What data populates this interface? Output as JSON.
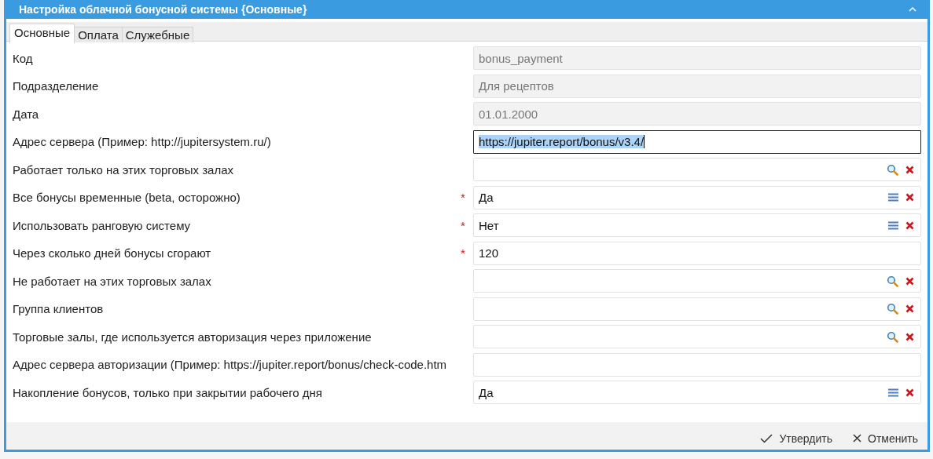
{
  "window": {
    "title": "Настройка облачной бонусной системы {Основные}"
  },
  "tabs": [
    {
      "label": "Основные",
      "selected": true
    },
    {
      "label": "Оплата",
      "selected": false
    },
    {
      "label": "Служебные",
      "selected": false
    }
  ],
  "fields": [
    {
      "label": "Код",
      "kind": "readonly",
      "value": "bonus_payment"
    },
    {
      "label": "Подразделение",
      "kind": "readonly",
      "value": "Для рецептов"
    },
    {
      "label": "Дата",
      "kind": "readonly",
      "value": "01.01.2000"
    },
    {
      "label": "Адрес сервера (Пример: http://jupitersystem.ru/)",
      "kind": "text",
      "value": "https://jupiter.report/bonus/v3.4/",
      "focused": true
    },
    {
      "label": "Работает только на этих торговых залах",
      "kind": "lookup"
    },
    {
      "label": "Все бонусы временные (beta, осторожно)",
      "kind": "select",
      "value": "Да",
      "required_mark": "*"
    },
    {
      "label": "Использовать ранговую систему",
      "kind": "select",
      "value": "Нет",
      "required_mark": "*"
    },
    {
      "label": "Через сколько дней бонусы сгорают",
      "kind": "text",
      "value": "120",
      "required_mark": "*",
      "focused": false
    },
    {
      "label": "Не работает на этих торговых залах",
      "kind": "lookup"
    },
    {
      "label": "Группа клиентов",
      "kind": "lookup"
    },
    {
      "label": "Торговые залы, где используется авторизация через приложение",
      "kind": "lookup"
    },
    {
      "label": "Адрес сервера авторизации (Пример: https://jupiter.report/bonus/check-code.htm",
      "kind": "text",
      "focused": false
    },
    {
      "label": "Накопление бонусов, только при закрытии рабочего дня",
      "kind": "select",
      "value": "Да"
    }
  ],
  "buttons": [
    {
      "label": "Утвердить",
      "kind": "confirm"
    },
    {
      "label": "Отменить",
      "kind": "cancel"
    }
  ]
}
